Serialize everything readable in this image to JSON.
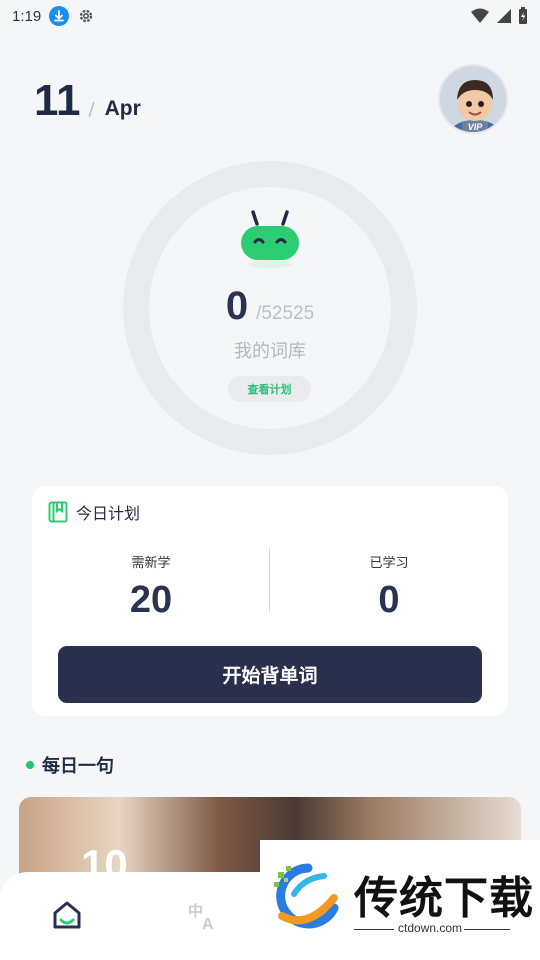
{
  "status_bar": {
    "time": "1:19"
  },
  "header": {
    "day": "11",
    "separator": "/",
    "month": "Apr"
  },
  "progress": {
    "learned": "0",
    "total": "/52525",
    "label": "我的词库",
    "plan_link": "查看计划"
  },
  "today_plan": {
    "title": "今日计划",
    "new_label": "需新学",
    "new_value": "20",
    "learned_label": "已学习",
    "learned_value": "0",
    "start_button": "开始背单词"
  },
  "daily_sentence": {
    "title": "每日一句",
    "overlay_text": "10"
  },
  "watermark": {
    "brand": "传统下载",
    "url": "ctdown.com"
  },
  "colors": {
    "accent_green": "#23c36e",
    "primary_dark": "#28304d",
    "ring_gray": "#eaebec"
  }
}
